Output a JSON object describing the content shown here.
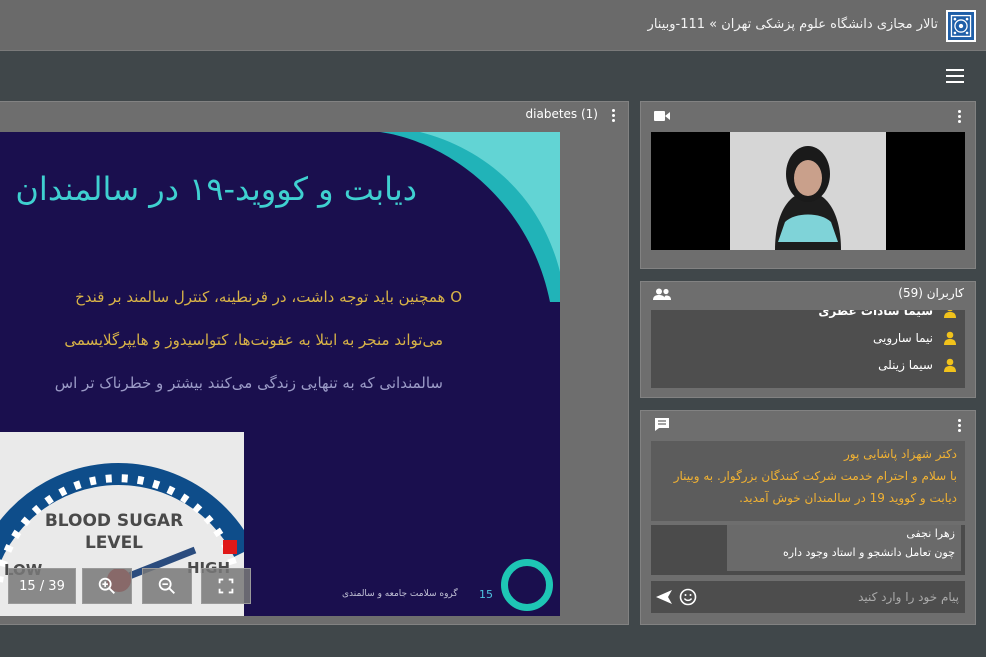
{
  "header": {
    "title": "تالار مجازی دانشگاه علوم پزشکی تهران » 111-وبینار"
  },
  "presentation": {
    "title": "diabetes (1)",
    "slide": {
      "title": "دیابت و کووید-۱۹ در سالمندان",
      "line1": "O همچنین باید توجه داشت، در قرنطینه، کنترل سالمند بر قندخ",
      "line2": "می‌تواند منجر به ابتلا به عفونت‌ها، کتواسیدوز و هایپرگلایسمی",
      "line3": "سالمندانی که به تنهایی زندگی می‌کنند بیشتر و خطرناک تر اس",
      "gauge_text_1": "BLOOD SUGAR",
      "gauge_text_2": "LEVEL",
      "gauge_low": "LOW",
      "gauge_high": "HIGH",
      "footer_num": "15",
      "footer_text": "گروه سلامت جامعه و سالمندی"
    },
    "page_indicator": "15 / 39"
  },
  "users": {
    "title": "کاربران (59)",
    "items": [
      {
        "name": "سیما سادات عطری"
      },
      {
        "name": "نیما سارویی"
      },
      {
        "name": "سیما زینلی"
      }
    ]
  },
  "chat": {
    "message1": {
      "sender": "دکتر شهزاد پاشایی پور",
      "text": "با سلام و احترام خدمت شرکت کنندگان بزرگوار. به وبینار دیابت و کووید 19 در سالمندان خوش آمدید."
    },
    "message2": {
      "sender": "زهرا نجفی",
      "text": "چون تعامل دانشجو و استاد وجود داره"
    },
    "input_placeholder": "پیام خود را وارد کنید"
  },
  "colors": {
    "accent_teal": "#3fd0d0",
    "slide_bg": "#1a0f4e",
    "chat_orange": "#f0b133",
    "user_icon": "#f1c21b"
  }
}
